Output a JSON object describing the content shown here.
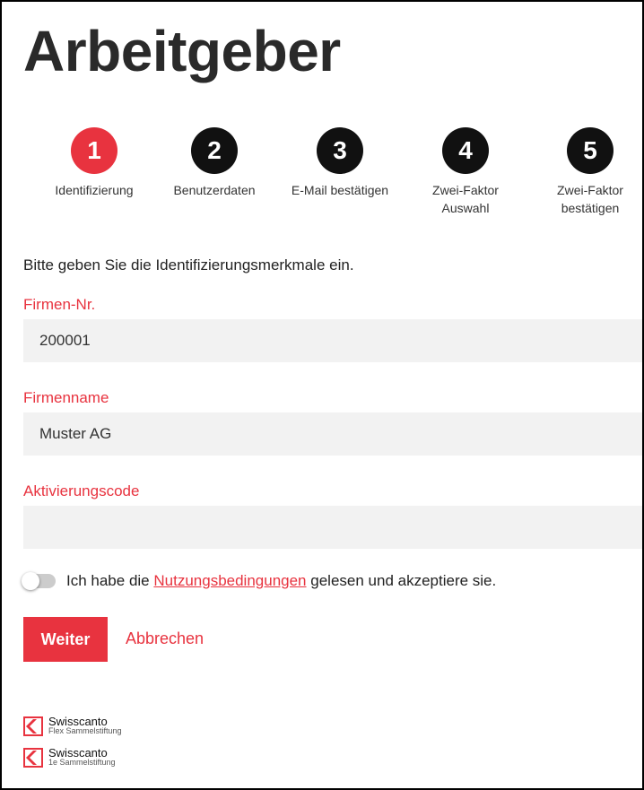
{
  "page": {
    "title": "Arbeitgeber"
  },
  "steps": [
    {
      "number": "1",
      "label": "Identifizierung",
      "active": true
    },
    {
      "number": "2",
      "label": "Benutzerdaten",
      "active": false
    },
    {
      "number": "3",
      "label": "E-Mail bestätigen",
      "active": false
    },
    {
      "number": "4",
      "label_line1": "Zwei-Faktor",
      "label_line2": "Auswahl",
      "active": false
    },
    {
      "number": "5",
      "label_line1": "Zwei-Faktor",
      "label_line2": "bestätigen",
      "active": false
    }
  ],
  "form": {
    "intro": "Bitte geben Sie die Identifizierungsmerkmale ein.",
    "company_no": {
      "label": "Firmen-Nr.",
      "value": "200001"
    },
    "company_name": {
      "label": "Firmenname",
      "value": "Muster AG"
    },
    "activation_code": {
      "label": "Aktivierungscode",
      "value": ""
    },
    "terms": {
      "prefix": "Ich habe die",
      "link": "Nutzungsbedingungen",
      "suffix": "gelesen und akzeptiere sie.",
      "accepted": false
    }
  },
  "actions": {
    "next": "Weiter",
    "cancel": "Abbrechen"
  },
  "footer": {
    "logos": [
      {
        "name": "Swisscanto",
        "sub": "Flex Sammelstiftung"
      },
      {
        "name": "Swisscanto",
        "sub": "1e Sammelstiftung"
      }
    ]
  },
  "colors": {
    "accent": "#e8333f",
    "step_inactive": "#111111",
    "field_bg": "#f2f2f2"
  }
}
